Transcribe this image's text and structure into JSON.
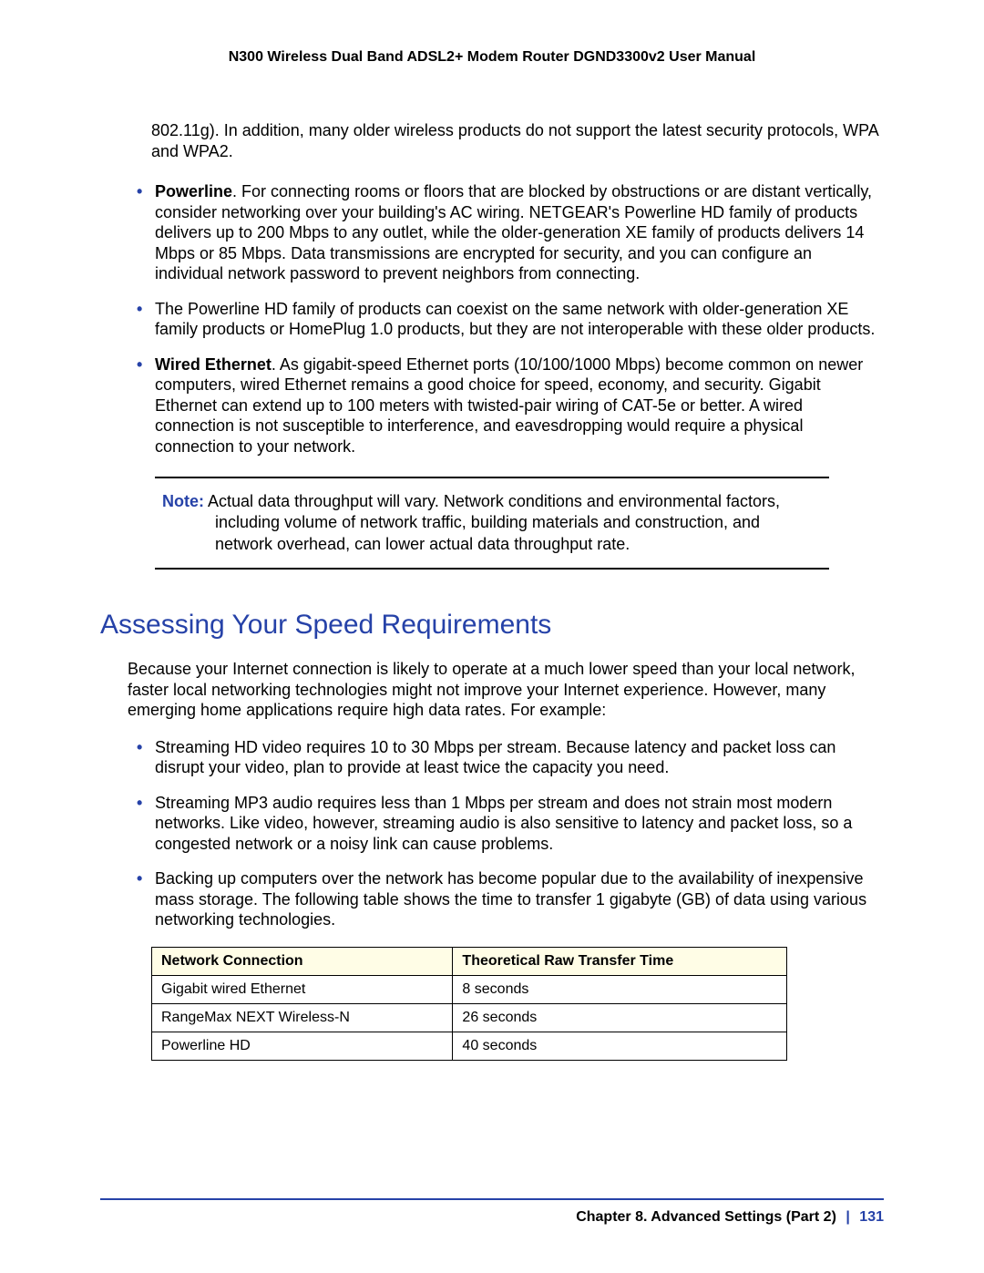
{
  "header": {
    "title": "N300 Wireless Dual Band ADSL2+ Modem Router DGND3300v2 User Manual"
  },
  "continuation": {
    "text": "802.11g). In addition, many older wireless products do not support the latest security protocols, WPA and WPA2."
  },
  "bullets_top": [
    {
      "lead": "Powerline",
      "text": ". For connecting rooms or floors that are blocked by obstructions or are distant vertically, consider networking over your building's AC wiring. NETGEAR's Powerline HD family of products delivers up to 200 Mbps to any outlet, while the older-generation XE family of products delivers 14 Mbps or 85 Mbps. Data transmissions are encrypted for security, and you can configure an individual network password to prevent neighbors from connecting."
    },
    {
      "lead": "",
      "text": "The Powerline HD family of products can coexist on the same network with older-generation XE family products or HomePlug 1.0 products, but they are not interoperable with these older products."
    },
    {
      "lead": "Wired Ethernet",
      "text": ". As gigabit-speed Ethernet ports (10/100/1000 Mbps) become common on newer computers, wired Ethernet remains a good choice for speed, economy, and security. Gigabit Ethernet can extend up to 100 meters with twisted-pair wiring of CAT-5e or better. A wired connection is not susceptible to interference, and eavesdropping would require a physical connection to your network."
    }
  ],
  "note": {
    "label": "Note:",
    "text": "Actual data throughput will vary. Network conditions and environmental factors, including volume of network traffic, building materials and construction, and network overhead, can lower actual data throughput rate."
  },
  "section": {
    "heading": "Assessing Your Speed Requirements",
    "intro": "Because your Internet connection is likely to operate at a much lower speed than your local network, faster local networking technologies might not improve your Internet experience. However, many emerging home applications require high data rates. For example:"
  },
  "bullets_section": [
    "Streaming HD video requires 10 to 30 Mbps per stream. Because latency and packet loss can disrupt your video, plan to provide at least twice the capacity you need.",
    "Streaming MP3 audio requires less than 1 Mbps per stream and does not strain most modern networks. Like video, however, streaming audio is also sensitive to latency and packet loss, so a congested network or a noisy link can cause problems.",
    "Backing up computers over the network has become popular due to the availability of inexpensive mass storage. The following table shows the time to transfer 1 gigabyte (GB) of data using various networking technologies."
  ],
  "table": {
    "headers": [
      "Network Connection",
      "Theoretical Raw Transfer Time"
    ],
    "rows": [
      [
        "Gigabit wired Ethernet",
        "8 seconds"
      ],
      [
        "RangeMax NEXT Wireless-N",
        "26 seconds"
      ],
      [
        "Powerline HD",
        "40 seconds"
      ]
    ]
  },
  "footer": {
    "chapter": "Chapter 8.  Advanced Settings (Part 2)",
    "page": "131"
  }
}
